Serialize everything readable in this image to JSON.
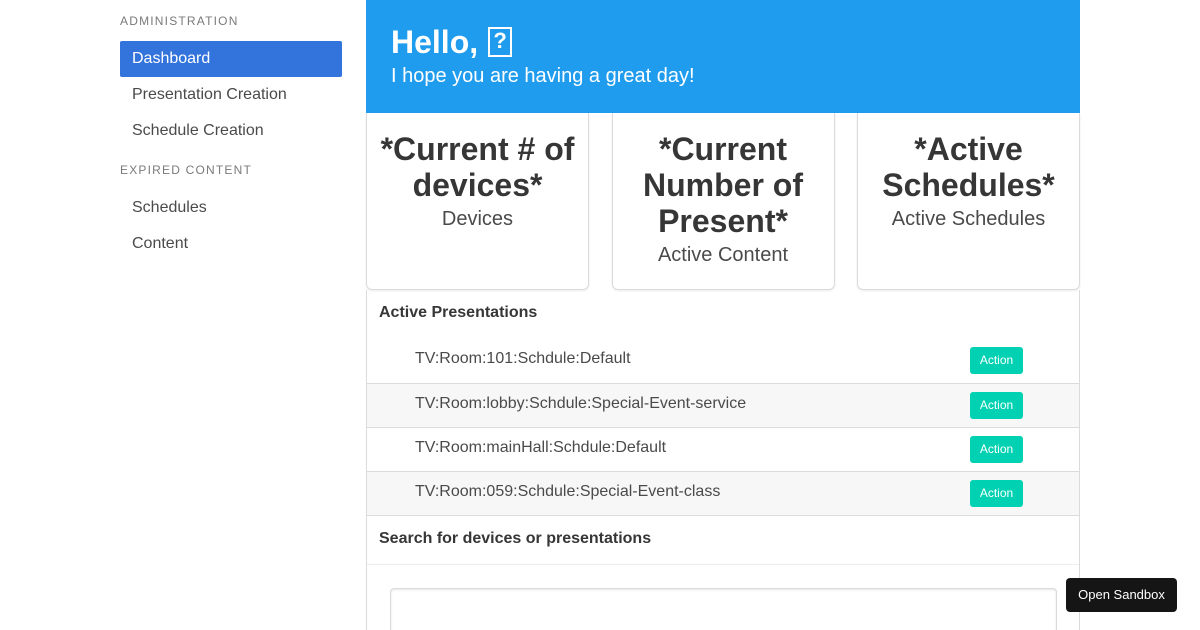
{
  "sidebar": {
    "admin_label": "ADMINISTRATION",
    "admin_items": [
      "Dashboard",
      "Presentation Creation",
      "Schedule Creation"
    ],
    "expired_label": "EXPIRED CONTENT",
    "expired_items": [
      "Schedules",
      "Content"
    ]
  },
  "hero": {
    "title": "Hello,",
    "glyph": "?",
    "subtitle": "I hope you are having a great day!"
  },
  "tiles": [
    {
      "title": "*Current # of devices*",
      "subtitle": "Devices"
    },
    {
      "title": "*Current Number of Present*",
      "subtitle": "Active Content"
    },
    {
      "title": "*Active Schedules*",
      "subtitle": "Active Schedules"
    }
  ],
  "active_presentations": {
    "heading": "Active Presentations",
    "rows": [
      {
        "name": "TV:Room:101:Schdule:Default",
        "action": "Action"
      },
      {
        "name": "TV:Room:lobby:Schdule:Special-Event-service",
        "action": "Action"
      },
      {
        "name": "TV:Room:mainHall:Schdule:Default",
        "action": "Action"
      },
      {
        "name": "TV:Room:059:Schdule:Special-Event-class",
        "action": "Action"
      }
    ]
  },
  "search": {
    "heading": "Search for devices or presentations",
    "placeholder": ""
  },
  "sandbox": {
    "label": "Open Sandbox"
  }
}
